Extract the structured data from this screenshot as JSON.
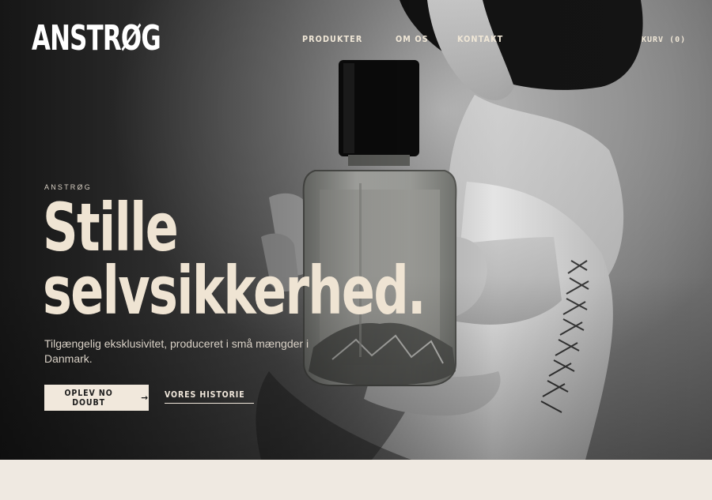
{
  "brand": {
    "logo": "ANSTRØG"
  },
  "nav": {
    "items": [
      {
        "label": "PRODUKTER"
      },
      {
        "label": "OM OS"
      },
      {
        "label": "KONTAKT"
      }
    ],
    "cart_label": "KURV (0)"
  },
  "hero": {
    "eyebrow": "ANSTRØG",
    "headline_line1": "Stille",
    "headline_line2": "selvsikkerhed.",
    "subtitle": "Tilgængelig eksklusivitet, produceret i små mængder i Danmark.",
    "primary_cta": "OPLEV NO DOUBT",
    "primary_cta_arrow": "→",
    "secondary_cta": "VORES HISTORIE"
  },
  "colors": {
    "accent_cream": "#f1e8dc",
    "headline": "#efe4d3",
    "page_bg": "#efe9e1"
  }
}
